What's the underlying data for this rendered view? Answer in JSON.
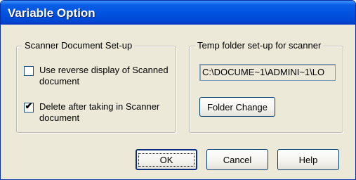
{
  "window": {
    "title": "Variable Option"
  },
  "scanner_group": {
    "legend": "Scanner Document Set-up",
    "reverse_display": {
      "label": "Use reverse display of Scanned document",
      "checked": false
    },
    "delete_after": {
      "label": "Delete after taking in Scanner document",
      "checked": true
    }
  },
  "temp_group": {
    "legend": "Temp folder set-up for scanner",
    "path_value": "C:\\DOCUME~1\\ADMINI~1\\LO",
    "folder_change_label": "Folder Change"
  },
  "buttons": {
    "ok": "OK",
    "cancel": "Cancel",
    "help": "Help"
  },
  "icons": {
    "check_mark": "✔"
  }
}
